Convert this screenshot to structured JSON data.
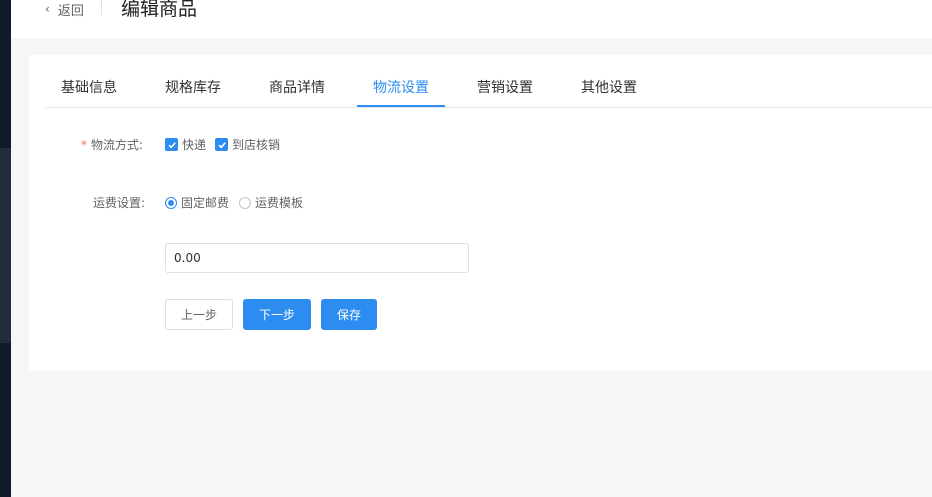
{
  "header": {
    "back_label": "返回",
    "title": "编辑商品"
  },
  "tabs": [
    {
      "label": "基础信息"
    },
    {
      "label": "规格库存"
    },
    {
      "label": "商品详情"
    },
    {
      "label": "物流设置"
    },
    {
      "label": "营销设置"
    },
    {
      "label": "其他设置"
    }
  ],
  "active_tab": "物流设置",
  "form": {
    "shipping_method": {
      "required_mark": "*",
      "label": "物流方式:",
      "options": [
        {
          "label": "快递",
          "checked": true
        },
        {
          "label": "到店核销",
          "checked": true
        }
      ]
    },
    "freight": {
      "label": "运费设置:",
      "options": [
        {
          "label": "固定邮费",
          "selected": true
        },
        {
          "label": "运费模板",
          "selected": false
        }
      ],
      "value": "0.00"
    }
  },
  "buttons": {
    "prev": "上一步",
    "next": "下一步",
    "save": "保存"
  },
  "colors": {
    "accent": "#2d8cf0",
    "sidebar": "#0f1a2a",
    "required": "#f56c6c"
  }
}
